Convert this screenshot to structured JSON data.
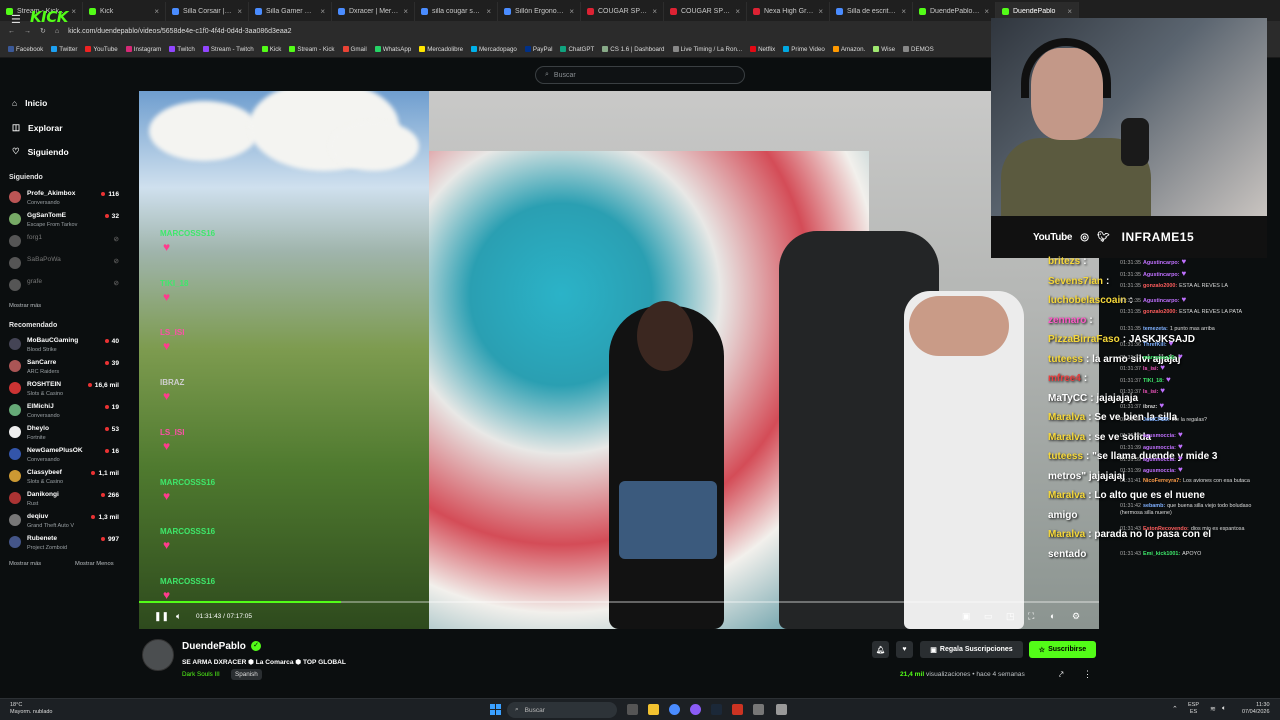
{
  "browser": {
    "tabs": [
      {
        "label": "Stream - Kick Dashb"
      },
      {
        "label": "Kick"
      },
      {
        "label": "Silla Corsair | Merca"
      },
      {
        "label": "Silla Gamer Corsair"
      },
      {
        "label": "Dxracer | Mercadoli"
      },
      {
        "label": "silla cougar speede"
      },
      {
        "label": "Sillón Ergonomics R"
      },
      {
        "label": "COUGAR SPEEDER"
      },
      {
        "label": "COUGAR SPEEDER"
      },
      {
        "label": "Nexa High Grey - In"
      },
      {
        "label": "Silla de escritorio R"
      },
      {
        "label": "DuendePablo - Wa"
      },
      {
        "label": "DuendePablo"
      }
    ],
    "url": "kick.com/duendepablo/videos/5658de4e-c1f0-4f4d-0d4d-3aa086d3eaa2",
    "bookmarks": [
      "Facebook",
      "Twitter",
      "YouTube",
      "Instagram",
      "Twitch",
      "Stream - Twitch",
      "Kick",
      "Stream - Kick",
      "Gmail",
      "WhatsApp",
      "Mercadolibre",
      "Mercadopago",
      "PayPal",
      "ChatGPT",
      "CS 1.6 | Dashboard",
      "Live Timing / La Ron...",
      "Netflix",
      "Prime Video",
      "Amazon.",
      "Wise",
      "DEMOS"
    ]
  },
  "header": {
    "logo": "KICK",
    "search_placeholder": "Buscar"
  },
  "sidebar": {
    "nav": [
      {
        "label": "Inicio"
      },
      {
        "label": "Explorar"
      },
      {
        "label": "Siguiendo"
      }
    ],
    "following_title": "Siguiendo",
    "following": [
      {
        "name": "Profe_Akimbox",
        "game": "Conversando",
        "viewers": "116",
        "online": true
      },
      {
        "name": "GgSanTomE",
        "game": "Escape From Tarkov",
        "viewers": "32",
        "online": true
      },
      {
        "name": "forg1",
        "game": "",
        "viewers": "",
        "online": false
      },
      {
        "name": "SaBaPoWa",
        "game": "",
        "viewers": "",
        "online": false
      },
      {
        "name": "grafe",
        "game": "",
        "viewers": "",
        "online": false
      }
    ],
    "show_more": "Mostrar más",
    "recommended_title": "Recomendado",
    "recommended": [
      {
        "name": "MoBauCGaming",
        "game": "Blood Strike",
        "viewers": "40"
      },
      {
        "name": "SanCarre",
        "game": "ARC Raiders",
        "viewers": "39"
      },
      {
        "name": "ROSHTEIN",
        "game": "Slots & Casino",
        "viewers": "16,6 mil"
      },
      {
        "name": "ElMichiJ",
        "game": "Conversando",
        "viewers": "19"
      },
      {
        "name": "Dheylo",
        "game": "Fortnite",
        "viewers": "53"
      },
      {
        "name": "NewGamePlusOK",
        "game": "Conversando",
        "viewers": "16"
      },
      {
        "name": "Classybeef",
        "game": "Slots & Casino",
        "viewers": "1,1 mil"
      },
      {
        "name": "Danikongi",
        "game": "Rust",
        "viewers": "266"
      },
      {
        "name": "deqiuv",
        "game": "Grand Theft Auto V",
        "viewers": "1,3 mil"
      },
      {
        "name": "Rubenete",
        "game": "Project Zomboid",
        "viewers": "997"
      }
    ],
    "show_more2": "Mostrar más",
    "show_less": "Mostrar Menos"
  },
  "player": {
    "time": "01:31:43 / 07:17:05",
    "progress": 0.21,
    "overlay_chat": [
      {
        "user": "MARCOSSS16",
        "color": "#3ee86b"
      },
      {
        "user": "TIKI_18",
        "color": "#3ee86b"
      },
      {
        "user": "LS_ISI",
        "color": "#ff4fa8"
      },
      {
        "user": "IBRAZ",
        "color": "#cfcfcf"
      },
      {
        "user": "LS_ISI",
        "color": "#ff4fa8"
      },
      {
        "user": "MARCOSSS16",
        "color": "#3ee86b"
      },
      {
        "user": "MARCOSSS16",
        "color": "#3ee86b"
      },
      {
        "user": "MARCOSSS16",
        "color": "#3ee86b"
      }
    ],
    "social_youtube": "YouTube",
    "social_brand": "INFRAME15",
    "stream_chat": [
      {
        "user": "britezs",
        "color": "#f6d83a",
        "msg": ""
      },
      {
        "user": "Sevens7ian",
        "color": "#f6d83a",
        "msg": ""
      },
      {
        "user": "luchobelascoain",
        "color": "#f6d83a",
        "msg": ""
      },
      {
        "user": "zennaro",
        "color": "#ff59c8",
        "msg": ""
      },
      {
        "user": "PizzaBirraFaso",
        "color": "#f6d83a",
        "msg": "JASKJKSAJD"
      },
      {
        "user": "tuteess",
        "color": "#f6d83a",
        "msg": "la armo silvi ajjajaj"
      },
      {
        "user": "mfree4",
        "color": "#e84040",
        "msg": ""
      },
      {
        "user": "MaTyCC",
        "color": "#ffffff",
        "msg": "jajajajaja"
      },
      {
        "user": "Maralva",
        "color": "#f6d83a",
        "msg": "Se ve bien la silla"
      },
      {
        "user": "Maralva",
        "color": "#f6d83a",
        "msg": "se ve solida"
      },
      {
        "user": "tuteess",
        "color": "#f6d83a",
        "msg": "\"se llama duende y mide 3"
      },
      {
        "user": "",
        "color": "#ffffff",
        "msg": "metros\" jajajajaj"
      },
      {
        "user": "Maralva",
        "color": "#f6d83a",
        "msg": "Lo alto que es el nuene"
      },
      {
        "user": "",
        "color": "#ffffff",
        "msg": "amigo"
      },
      {
        "user": "Maralva",
        "color": "#f6d83a",
        "msg": "parada no lo pasa con el"
      },
      {
        "user": "",
        "color": "#ffffff",
        "msg": "sentado"
      }
    ]
  },
  "replay_chat": [
    {
      "t": "01:31:35",
      "user": "Agustincarpo:",
      "color": "#c070ff",
      "msg": ""
    },
    {
      "t": "01:31:35",
      "user": "Agustincarpo:",
      "color": "#c070ff",
      "msg": ""
    },
    {
      "t": "01:31:35",
      "user": "gonzalo2000:",
      "color": "#ff5d5d",
      "msg": "ESTA AL REVES LA"
    },
    {
      "t": "01:31:35",
      "user": "Agustincarpo:",
      "color": "#c070ff",
      "msg": ""
    },
    {
      "t": "01:31:35",
      "user": "gonzalo2000:",
      "color": "#ff5d5d",
      "msg": "ESTA AL REVES LA PATA"
    },
    {
      "t": "01:31:35",
      "user": "temezeta:",
      "color": "#7fb0ff",
      "msg": "1 punto mas arriba"
    },
    {
      "t": "01:31:36",
      "user": "ThrefKill:",
      "color": "#7fb0ff",
      "msg": ""
    },
    {
      "t": "01:31:37",
      "user": "marcosss16:",
      "color": "#3ee86b",
      "msg": ""
    },
    {
      "t": "01:31:37",
      "user": "ls_isi:",
      "color": "#ff59c8",
      "msg": ""
    },
    {
      "t": "01:31:37",
      "user": "TIKI_18:",
      "color": "#3ee86b",
      "msg": ""
    },
    {
      "t": "01:31:37",
      "user": "ls_isi:",
      "color": "#ff59c8",
      "msg": ""
    },
    {
      "t": "01:31:37",
      "user": "ibraz:",
      "color": "#cfcfcf",
      "msg": ""
    },
    {
      "t": "01:31:38",
      "user": "JotaCH29:",
      "color": "#7fb0ff",
      "msg": "me la regalas?"
    },
    {
      "t": "01:31:38",
      "user": "agusmoccia:",
      "color": "#c070ff",
      "msg": ""
    },
    {
      "t": "01:31:39",
      "user": "agusmoccia:",
      "color": "#c070ff",
      "msg": ""
    },
    {
      "t": "01:31:39",
      "user": "agusmoccia:",
      "color": "#c070ff",
      "msg": ""
    },
    {
      "t": "01:31:39",
      "user": "agusmoccia:",
      "color": "#c070ff",
      "msg": ""
    },
    {
      "t": "01:31:41",
      "user": "NicoFerreyra7:",
      "color": "#ff9e4a",
      "msg": "Los aviones con esa butaca"
    },
    {
      "t": "01:31:42",
      "user": "sebamb:",
      "color": "#7fb0ff",
      "msg": "que buena silla viejo todo boludaso (hermosa silla nuene)"
    },
    {
      "t": "01:31:43",
      "user": "EstonRecovendo:",
      "color": "#ff5d5d",
      "msg": "dios mio es espantosa"
    },
    {
      "t": "01:31:43",
      "user": "Emi_kick1001:",
      "color": "#3ee86b",
      "msg": "APOYO"
    }
  ],
  "stream_info": {
    "streamer": "DuendePablo",
    "title": "SE ARMA DXRACER ⬢ La Comarca ⬢ TOP GLOBAL",
    "game": "Dark Souls III",
    "language": "Spanish",
    "gift_label": "Regala Suscripciones",
    "subscribe_label": "Suscribirse",
    "views": "21,4 mil",
    "views_suffix": "visualizaciones",
    "posted": "hace 4 semanas"
  },
  "taskbar": {
    "weather_temp": "18°C",
    "weather_desc": "Mayorm. nublado",
    "search": "Buscar",
    "lang": "ESP",
    "lang2": "ES",
    "time": "11:30",
    "date": "07/04/2026"
  },
  "colors": {
    "kick_green": "#53fc18",
    "live_red": "#ea3233"
  }
}
